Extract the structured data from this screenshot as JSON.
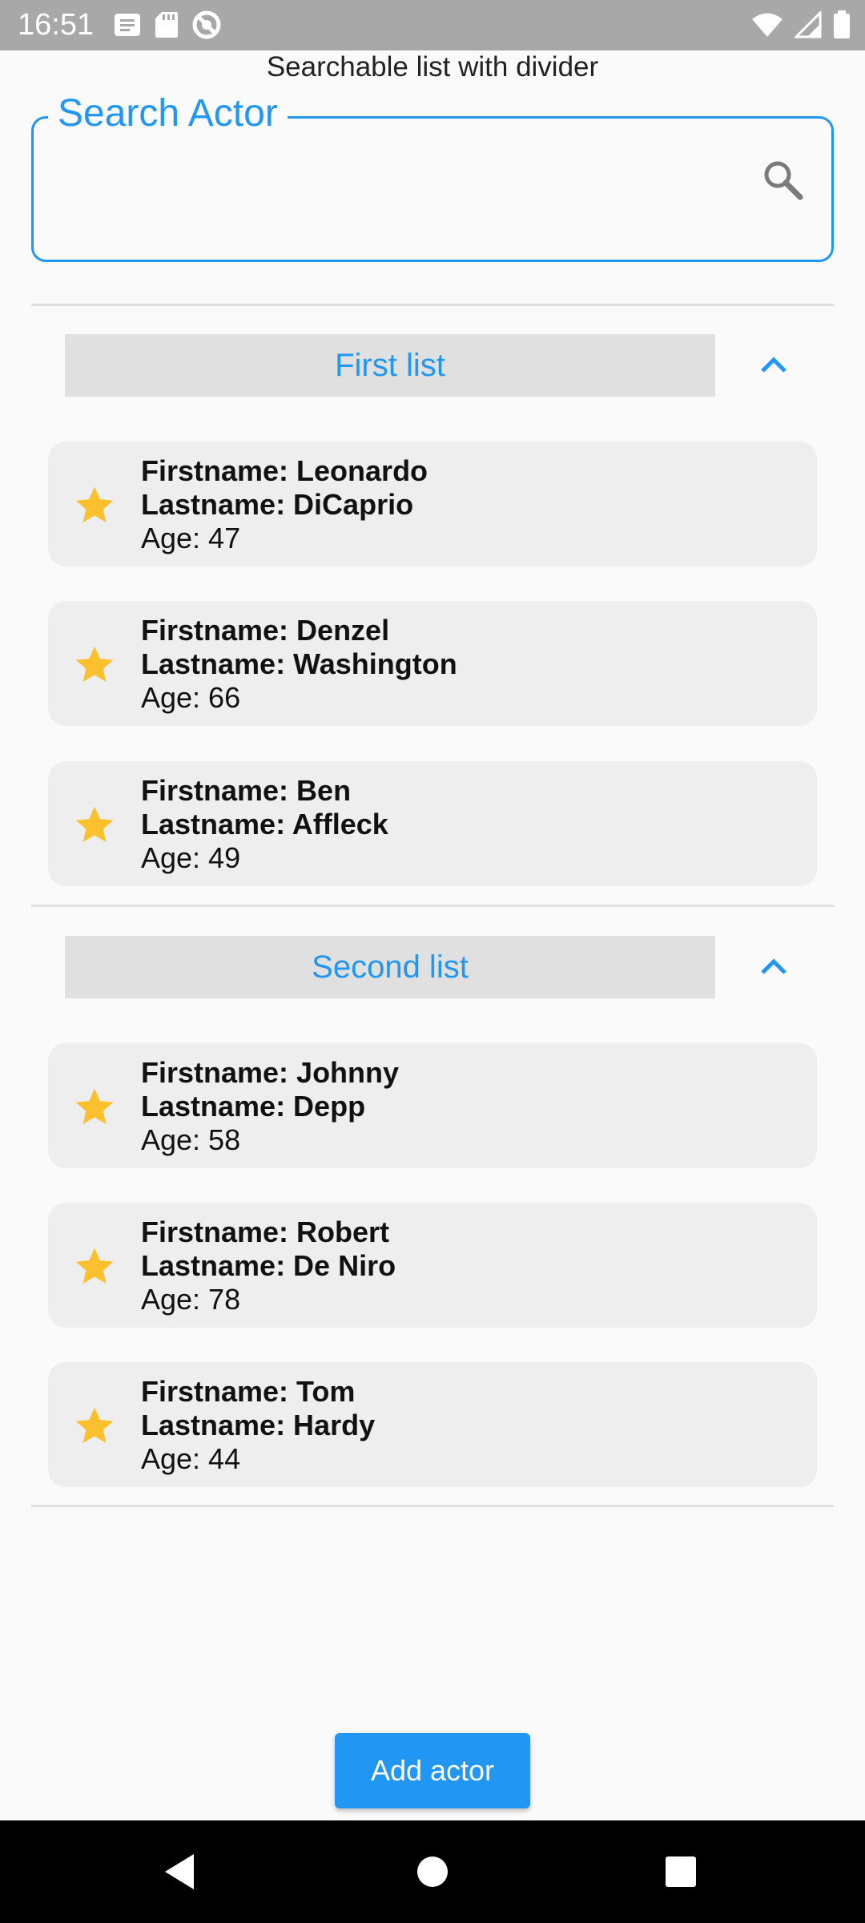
{
  "status_bar": {
    "time": "16:51",
    "left_icons": [
      "notification-icon",
      "sd-card-icon",
      "do-not-disturb-icon"
    ],
    "right_icons": [
      "wifi-icon",
      "signal-icon",
      "battery-icon"
    ]
  },
  "app": {
    "title": "Searchable list with divider"
  },
  "search": {
    "label": "Search Actor",
    "value": "",
    "placeholder": ""
  },
  "sections": [
    {
      "header": "First list",
      "expanded": true,
      "items": [
        {
          "firstname_label": "Firstname: Leonardo",
          "lastname_label": "Lastname: DiCaprio",
          "age_label": "Age: 47"
        },
        {
          "firstname_label": "Firstname: Denzel",
          "lastname_label": "Lastname: Washington",
          "age_label": "Age: 66"
        },
        {
          "firstname_label": "Firstname: Ben",
          "lastname_label": "Lastname: Affleck",
          "age_label": "Age: 49"
        }
      ]
    },
    {
      "header": "Second list",
      "expanded": true,
      "items": [
        {
          "firstname_label": "Firstname: Johnny",
          "lastname_label": "Lastname: Depp",
          "age_label": "Age: 58"
        },
        {
          "firstname_label": "Firstname: Robert",
          "lastname_label": "Lastname: De Niro",
          "age_label": "Age: 78"
        },
        {
          "firstname_label": "Firstname: Tom",
          "lastname_label": "Lastname: Hardy",
          "age_label": "Age: 44"
        }
      ]
    }
  ],
  "add_button": {
    "label": "Add actor"
  },
  "colors": {
    "accent": "#2196f3",
    "star": "#fbc02d",
    "card_background": "#eeeeee",
    "header_background": "#e0e0e0"
  },
  "nav_bar": {
    "icons": [
      "back-icon",
      "home-icon",
      "recents-icon"
    ]
  }
}
